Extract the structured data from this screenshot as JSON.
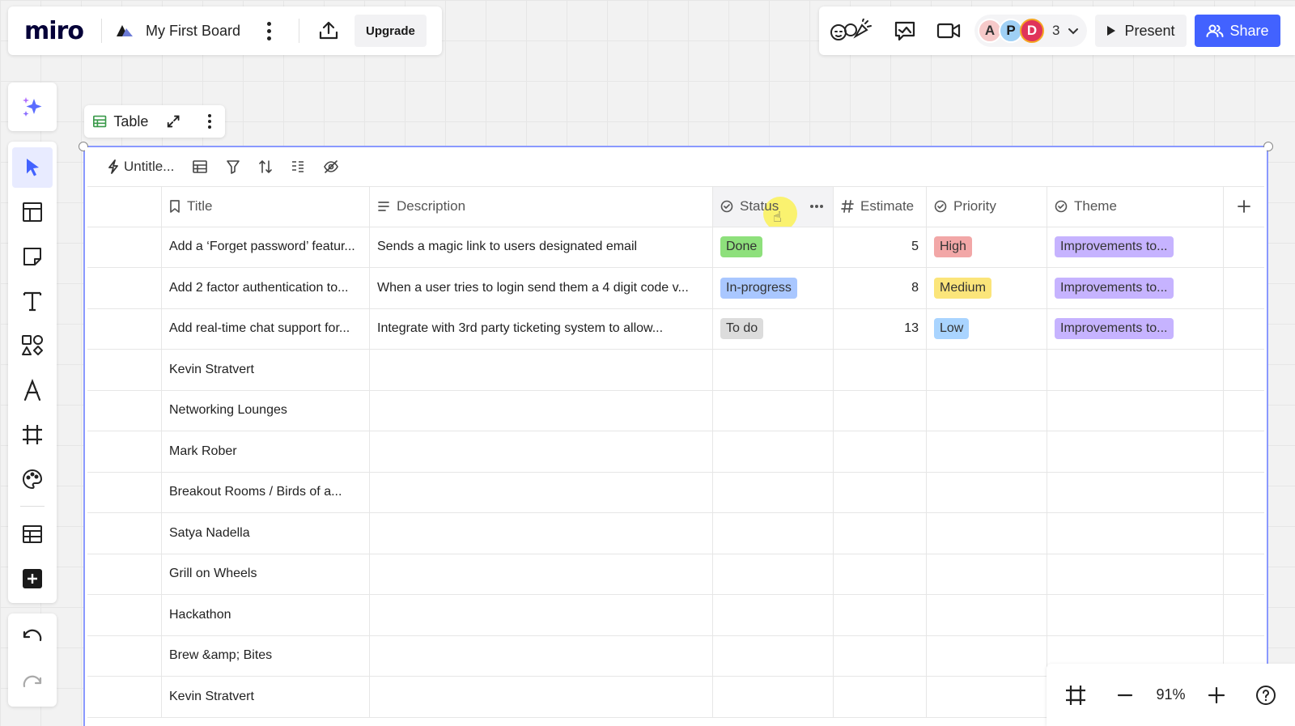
{
  "app": {
    "logo": "miro",
    "board_name": "My First Board",
    "upgrade_label": "Upgrade"
  },
  "header_right": {
    "avatars": [
      {
        "initial": "A",
        "color": "#f6c9c9"
      },
      {
        "initial": "P",
        "color": "#9fd0f5"
      },
      {
        "initial": "D",
        "color": "#e0335a"
      }
    ],
    "avatar_count": "3",
    "present_label": "Present",
    "share_label": "Share"
  },
  "table_chip": {
    "label": "Table"
  },
  "table": {
    "name": "Untitle...",
    "columns": [
      {
        "label": "",
        "icon": "none"
      },
      {
        "label": "Title",
        "icon": "bookmark-icon"
      },
      {
        "label": "Description",
        "icon": "lines-icon"
      },
      {
        "label": "Status",
        "icon": "status-icon"
      },
      {
        "label": "Estimate",
        "icon": "hash-icon"
      },
      {
        "label": "Priority",
        "icon": "status-icon"
      },
      {
        "label": "Theme",
        "icon": "status-icon"
      }
    ],
    "rows": [
      {
        "title": "Add a ‘Forget password’ featur...",
        "description": "Sends a magic link to users designated email",
        "status": "Done",
        "estimate": "5",
        "priority": "High",
        "theme": "Improvements to..."
      },
      {
        "title": "Add 2 factor authentication to...",
        "description": "When a user tries to login send them a 4 digit code v...",
        "status": "In-progress",
        "estimate": "8",
        "priority": "Medium",
        "theme": "Improvements to..."
      },
      {
        "title": "Add real-time chat support for...",
        "description": "Integrate with 3rd party ticketing system to allow...",
        "status": "To do",
        "estimate": "13",
        "priority": "Low",
        "theme": "Improvements to..."
      },
      {
        "title": "Kevin Stratvert",
        "description": "",
        "status": "",
        "estimate": "",
        "priority": "",
        "theme": ""
      },
      {
        "title": "Networking Lounges",
        "description": "",
        "status": "",
        "estimate": "",
        "priority": "",
        "theme": ""
      },
      {
        "title": "Mark Rober",
        "description": "",
        "status": "",
        "estimate": "",
        "priority": "",
        "theme": ""
      },
      {
        "title": "Breakout Rooms / Birds of a...",
        "description": "",
        "status": "",
        "estimate": "",
        "priority": "",
        "theme": ""
      },
      {
        "title": "Satya Nadella",
        "description": "",
        "status": "",
        "estimate": "",
        "priority": "",
        "theme": ""
      },
      {
        "title": "Grill on Wheels",
        "description": "",
        "status": "",
        "estimate": "",
        "priority": "",
        "theme": ""
      },
      {
        "title": "Hackathon",
        "description": "",
        "status": "",
        "estimate": "",
        "priority": "",
        "theme": ""
      },
      {
        "title": "Brew &amp; Bites",
        "description": "",
        "status": "",
        "estimate": "",
        "priority": "",
        "theme": ""
      },
      {
        "title": "Kevin Stratvert",
        "description": "",
        "status": "",
        "estimate": "",
        "priority": "",
        "theme": ""
      }
    ],
    "tag_colors": {
      "Done": "#8ee07c",
      "In-progress": "#a9c7ff",
      "To do": "#dcdcdc",
      "High": "#f2a7a7",
      "Medium": "#fbe57a",
      "Low": "#a9d4ff",
      "Improvements to...": "#c6b3ff"
    }
  },
  "zoom": {
    "level": "91%"
  },
  "colors": {
    "accent": "#4262ff",
    "selection": "#8a99ff"
  }
}
